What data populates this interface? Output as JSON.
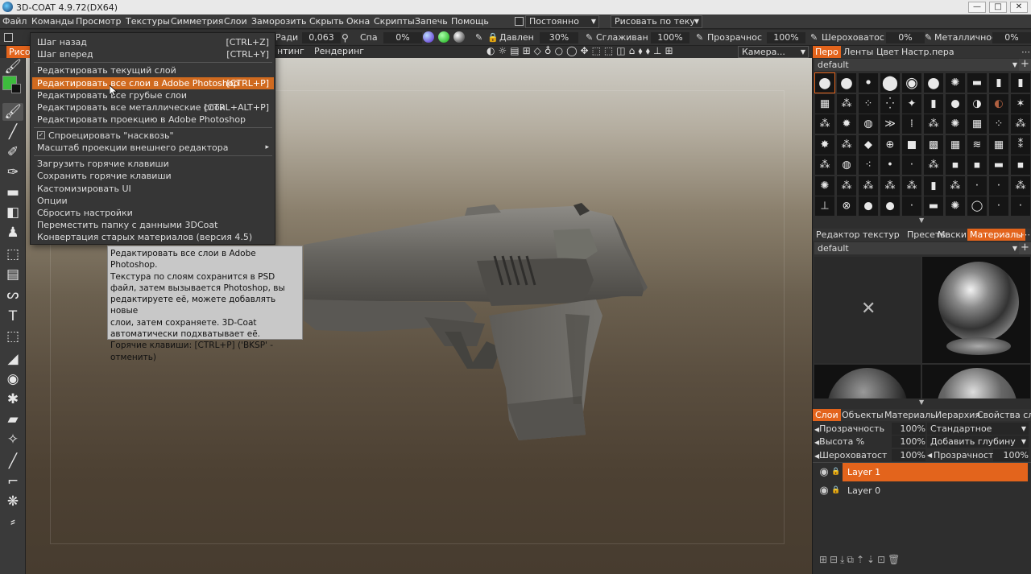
{
  "window": {
    "title": "3D-COAT 4.9.72(DX64)",
    "controls": [
      "—",
      "□",
      "✕"
    ]
  },
  "menubar": {
    "items": [
      "Файл",
      "Команды",
      "Просмотр",
      "Текстуры",
      "Симметрия",
      "Слои",
      "Заморозить",
      "Скрыть",
      "Окна",
      "Скрипты",
      "Запечь",
      "Помощь"
    ],
    "constant_label": "Постоянно",
    "paint_mode": "Рисовать по теку"
  },
  "toolbar": {
    "radius_label": "Ради",
    "radius_value": "0,063",
    "falloff_label": "Спа",
    "falloff_value": "0%",
    "pressure_label": "Давлен",
    "pressure_value": "30%",
    "smooth_label": "Сглаживан",
    "smooth_value": "100%",
    "opacity_label": "Прозрачнос",
    "opacity_value": "100%",
    "roughness_label": "Шероховатос",
    "roughness_value": "0%",
    "metal_label": "Металличнос",
    "metal_value": "0%",
    "ws_tab": "Рисо",
    "tab_partial": "нтинг",
    "tab_render": "Рендеринг",
    "camera": "Камера..."
  },
  "menu": {
    "items": [
      {
        "label": "Шаг назад",
        "shortcut": "[CTRL+Z]"
      },
      {
        "label": "Шаг вперед",
        "shortcut": "[CTRL+Y]"
      },
      {
        "label": "Редактировать текущий слой",
        "shortcut": ""
      },
      {
        "label": "Редактировать все слои в Adobe Photoshop",
        "shortcut": "[CTRL+P]"
      },
      {
        "label": "Редактировать все грубые слои",
        "shortcut": ""
      },
      {
        "label": "Редактировать все металлические слои",
        "shortcut": "[CTRL+ALT+P]"
      },
      {
        "label": "Редактировать проекцию в Adobe Photoshop",
        "shortcut": ""
      },
      {
        "label": "Спроецировать \"насквозь\"",
        "shortcut": ""
      },
      {
        "label": "Масштаб проекции внешнего редактора",
        "shortcut": ""
      },
      {
        "label": "Загрузить горячие клавиши",
        "shortcut": ""
      },
      {
        "label": "Сохранить горячие клавиши",
        "shortcut": ""
      },
      {
        "label": "Кастомизировать UI",
        "shortcut": ""
      },
      {
        "label": "Опции",
        "shortcut": ""
      },
      {
        "label": "Сбросить настройки",
        "shortcut": ""
      },
      {
        "label": "Переместить папку с данными 3DCoat",
        "shortcut": ""
      },
      {
        "label": "Конвертация старых материалов (версия 4.5)",
        "shortcut": ""
      }
    ]
  },
  "tooltip": {
    "lines": [
      "Редактировать все слои в Adobe Photoshop.",
      "Текстура по слоям сохранится в PSD",
      "файл, затем вызывается Photoshop, вы",
      "редактируете её, можете добавлять новые",
      "слои, затем сохраняете. 3D-Coat",
      "автоматически подхватывает её.",
      "Горячие клавиши: [CTRL+P]   ('BKSP' -",
      "отменить)"
    ]
  },
  "panel_brushes": {
    "tabs": [
      "Перо",
      "Ленты",
      "Цвет",
      "Настр.пера"
    ],
    "preset": "default"
  },
  "panel_materials": {
    "tabs": [
      "Редактор текстур",
      "Пресеты",
      "Маски",
      "Материалы"
    ],
    "preset": "default"
  },
  "panel_layers": {
    "tabs": [
      "Слои",
      "Объекты",
      "Материалы",
      "Иерархия",
      "Свойства сл"
    ],
    "opacity_label": "Прозрачность",
    "opacity_value": "100%",
    "blend_mode": "Стандартное",
    "height_label": "Высота  %",
    "height_value": "100%",
    "depth_mode": "Добавить глубину",
    "rough_label": "Шероховатост",
    "rough_value": "100%",
    "opacity2_label": "Прозрачность",
    "opacity2_value": "100%",
    "layers": [
      "Layer  1",
      "Layer  0"
    ]
  },
  "colors": {
    "accent": "#e3641c",
    "highlight": "#d06a1f",
    "primary_color": "#3dbb3d"
  }
}
